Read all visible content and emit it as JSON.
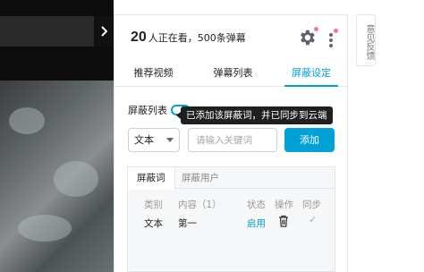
{
  "header": {
    "viewer_count": "20",
    "viewer_text": "人正在看，500条弹幕"
  },
  "tabs": [
    {
      "label": "推荐视频"
    },
    {
      "label": "弹幕列表"
    },
    {
      "label": "屏蔽设定"
    }
  ],
  "block": {
    "list_label": "屏蔽列表",
    "tooltip": "已添加该屏蔽词，并已同步到云端",
    "type_value": "文本",
    "input_placeholder": "请输入关键词",
    "add_label": "添加"
  },
  "list": {
    "sub_tabs": [
      {
        "label": "屏蔽词"
      },
      {
        "label": "屏蔽用户"
      }
    ],
    "columns": [
      "类别",
      "内容（1）",
      "状态",
      "操作",
      "同步"
    ],
    "rows": [
      {
        "type": "文本",
        "content": "第一",
        "status": "启用",
        "sync": "✓"
      }
    ]
  },
  "feedback_label": "意见反馈",
  "colors": {
    "accent": "#00a1d6",
    "badge": "#fb7299"
  },
  "icons": [
    "settings-gear-icon",
    "more-vertical-icon",
    "collapse-chevron-icon",
    "trash-icon",
    "check-icon"
  ]
}
